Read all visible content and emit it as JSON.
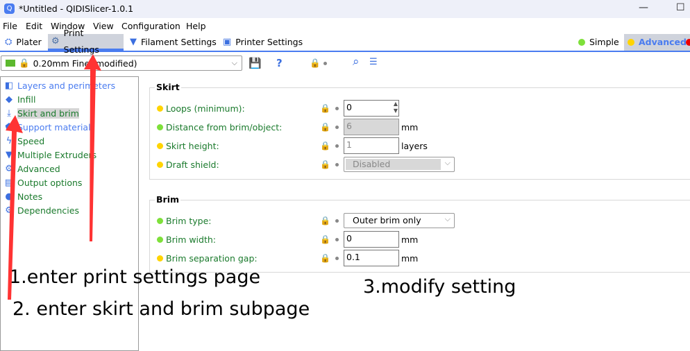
{
  "window": {
    "title": "*Untitled - QIDISlicer-1.0.1",
    "logo_icon": "qidi-logo-icon",
    "minimize": "—",
    "maximize": "☐"
  },
  "menu": [
    "File",
    "Edit",
    "Window",
    "View",
    "Configuration",
    "Help"
  ],
  "tabs": [
    {
      "label": "Plater",
      "icon": "plater-icon"
    },
    {
      "label": "Print Settings",
      "icon": "gear-icon",
      "active": true
    },
    {
      "label": "Filament Settings",
      "icon": "filament-icon"
    },
    {
      "label": "Printer Settings",
      "icon": "printer-icon"
    }
  ],
  "mode": {
    "simple": "Simple",
    "advanced": "Advanced",
    "simple_color": "#7ee03a",
    "advanced_color": "#ffd400",
    "active": "Advanced"
  },
  "preset": {
    "value": "0.20mm Fine (modified)"
  },
  "sidebar": {
    "items": [
      {
        "label": "Layers and perimeters",
        "color": "#4a7cf0"
      },
      {
        "label": "Infill"
      },
      {
        "label": "Skirt and brim",
        "selected": true
      },
      {
        "label": "Support material",
        "color": "#4a7cf0"
      },
      {
        "label": "Speed"
      },
      {
        "label": "Multiple Extruders"
      },
      {
        "label": "Advanced"
      },
      {
        "label": "Output options"
      },
      {
        "label": "Notes"
      },
      {
        "label": "Dependencies"
      }
    ]
  },
  "skirt": {
    "title": "Skirt",
    "rows": [
      {
        "label": "Loops (minimum):",
        "value": "0",
        "mode": "advanced"
      },
      {
        "label": "Distance from brim/object:",
        "value": "6",
        "unit": "mm",
        "mode": "simple",
        "disabled": true
      },
      {
        "label": "Skirt height:",
        "value": "1",
        "unit": "layers",
        "mode": "advanced"
      },
      {
        "label": "Draft shield:",
        "value": "Disabled",
        "mode": "advanced",
        "disabled": true
      }
    ]
  },
  "brim": {
    "title": "Brim",
    "rows": [
      {
        "label": "Brim type:",
        "value": "Outer brim only",
        "mode": "simple"
      },
      {
        "label": "Brim width:",
        "value": "0",
        "unit": "mm",
        "mode": "simple"
      },
      {
        "label": "Brim separation gap:",
        "value": "0.1",
        "unit": "mm",
        "mode": "advanced"
      }
    ]
  },
  "annotations": {
    "step1": "1.enter print settings page",
    "step2": "2. enter skirt and brim subpage",
    "step3": "3.modify setting",
    "arrow_color": "#ff3333"
  }
}
